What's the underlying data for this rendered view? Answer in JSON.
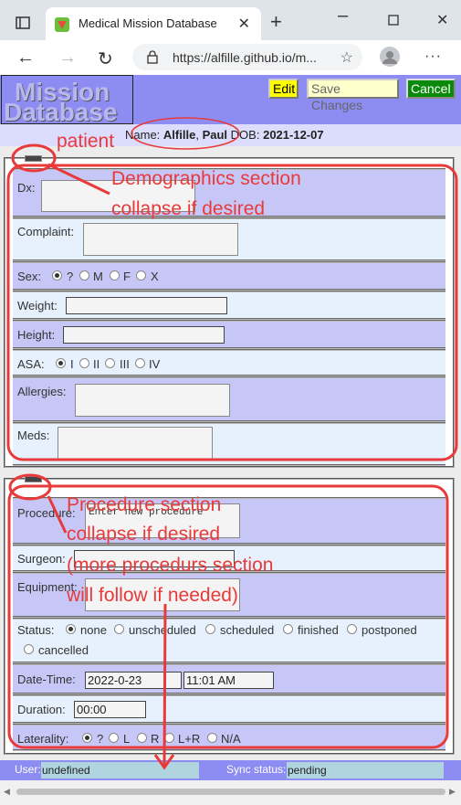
{
  "browser": {
    "tab_title": "Medical Mission Database",
    "url": "https://alfille.github.io/m..."
  },
  "header": {
    "logo_line1": "Mission",
    "logo_line2": "Database",
    "edit": "Edit",
    "save": "Save Changes",
    "cancel": "Cancel"
  },
  "patient": {
    "name_label": "Name:",
    "last": "Alfille",
    "sep": ",",
    "first": "Paul",
    "dob_label": "DOB:",
    "dob": "2021-12-07"
  },
  "demographics": {
    "dx": "Dx:",
    "complaint": "Complaint:",
    "sex": "Sex:",
    "sex_options": [
      "?",
      "M",
      "F",
      "X"
    ],
    "sex_selected": "?",
    "weight": "Weight:",
    "height": "Height:",
    "asa": "ASA:",
    "asa_options": [
      "I",
      "II",
      "III",
      "IV"
    ],
    "asa_selected": "I",
    "allergies": "Allergies:",
    "meds": "Meds:"
  },
  "procedure": {
    "procedure": "Procedure:",
    "procedure_placeholder": "Enter new procedure",
    "surgeon": "Surgeon:",
    "equipment": "Equipment:",
    "status": "Status:",
    "status_options": [
      "none",
      "unscheduled",
      "scheduled",
      "finished",
      "postponed",
      "cancelled"
    ],
    "status_selected": "none",
    "datetime": "Date-Time:",
    "date_value": "2022-0-23",
    "time_value": "11:01 AM",
    "duration": "Duration:",
    "duration_value": "00:00",
    "laterality": "Laterality:",
    "laterality_options": [
      "?",
      "L",
      "R",
      "L+R",
      "N/A"
    ],
    "laterality_selected": "?"
  },
  "statusbar": {
    "user_label": "User:",
    "user_value": "undefined",
    "sync_label": "Sync status:",
    "sync_value": "pending"
  },
  "annotations": {
    "patient": "patient",
    "demo1": "Demographics section",
    "demo2": "collapse if desired",
    "proc1": "Procedure section",
    "proc2": "collapse if desired",
    "proc3": "(more procedurs section",
    "proc4": "will follow if needed)"
  },
  "colors": {
    "header_bg": "#8c8cf2",
    "row_odd": "#c7c7f7",
    "row_even": "#e6f1fd",
    "annotation": "#e83a3a",
    "cancel_bg": "#0a8a0a",
    "edit_bg": "#ffff00"
  }
}
